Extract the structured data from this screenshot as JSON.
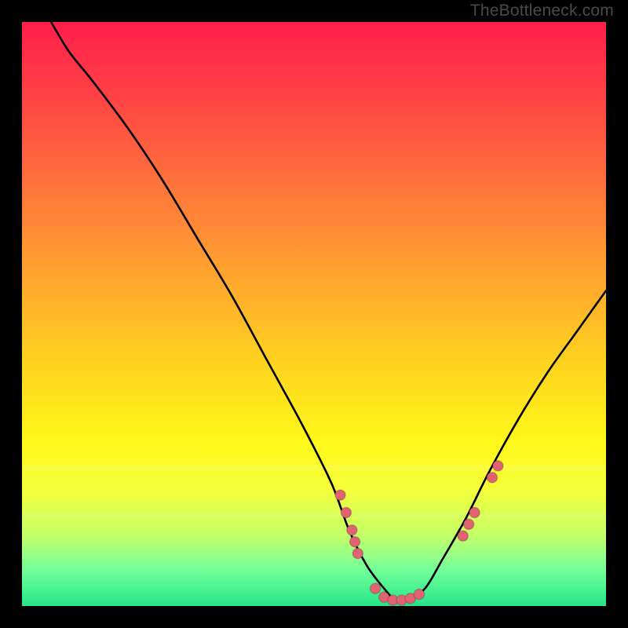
{
  "watermark": "TheBottleneck.com",
  "chart_data": {
    "type": "line",
    "title": "",
    "xlabel": "",
    "ylabel": "",
    "xlim": [
      0,
      100
    ],
    "ylim": [
      0,
      100
    ],
    "grid": false,
    "legend": false,
    "background": "vertical red-to-green gradient (bottleneck = green at bottom)",
    "series": [
      {
        "name": "bottleneck-curve",
        "x": [
          5,
          8,
          12,
          18,
          24,
          30,
          36,
          42,
          48,
          53,
          56,
          59,
          62,
          64,
          66,
          69,
          72,
          76,
          80,
          85,
          90,
          95,
          100
        ],
        "y": [
          100,
          95,
          90,
          82,
          73,
          63,
          53,
          42,
          31,
          21,
          13,
          7,
          3,
          1,
          1,
          3,
          8,
          15,
          23,
          32,
          40,
          47,
          54
        ]
      }
    ],
    "annotations": [
      {
        "name": "highlight-dot",
        "x": 54.5,
        "y": 19
      },
      {
        "name": "highlight-dot",
        "x": 55.5,
        "y": 16
      },
      {
        "name": "highlight-dot",
        "x": 56.5,
        "y": 13
      },
      {
        "name": "highlight-dot",
        "x": 57.0,
        "y": 11
      },
      {
        "name": "highlight-dot",
        "x": 57.5,
        "y": 9
      },
      {
        "name": "highlight-dot",
        "x": 60.5,
        "y": 3
      },
      {
        "name": "highlight-dot",
        "x": 62.0,
        "y": 1.5
      },
      {
        "name": "highlight-dot",
        "x": 63.5,
        "y": 1
      },
      {
        "name": "highlight-dot",
        "x": 65.0,
        "y": 1
      },
      {
        "name": "highlight-dot",
        "x": 66.5,
        "y": 1.3
      },
      {
        "name": "highlight-dot",
        "x": 68.0,
        "y": 2
      },
      {
        "name": "highlight-dot",
        "x": 75.5,
        "y": 12
      },
      {
        "name": "highlight-dot",
        "x": 76.5,
        "y": 14
      },
      {
        "name": "highlight-dot",
        "x": 77.5,
        "y": 16
      },
      {
        "name": "highlight-dot",
        "x": 80.5,
        "y": 22
      },
      {
        "name": "highlight-dot",
        "x": 81.5,
        "y": 24
      }
    ]
  }
}
